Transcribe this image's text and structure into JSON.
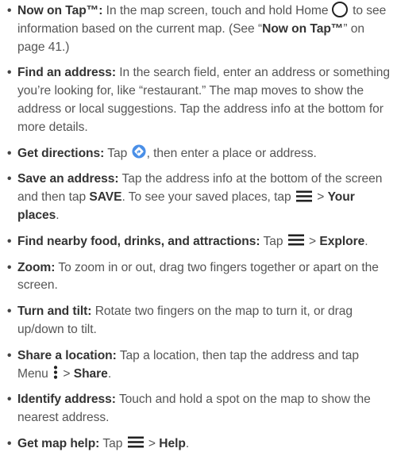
{
  "items": [
    {
      "term": "Now on Tap™:",
      "text1": " In the map screen, touch and hold Home ",
      "icon": "home-circle-icon",
      "text2": " to see information based on the current map. (See “",
      "link": "Now on Tap™",
      "text3": "” on page 41.)"
    },
    {
      "term": "Find an address:",
      "text": " In the search field, enter an address or something you’re looking for, like “restaurant.” The map moves to show the address or local suggestions. Tap the address info at the bottom for more details."
    },
    {
      "term": "Get directions:",
      "text1": " Tap ",
      "icon": "directions-icon",
      "text2": ", then enter a place or address."
    },
    {
      "term": "Save an address:",
      "text1": " Tap the address info at the bottom of the screen and then tap ",
      "strong1": "SAVE",
      "text2": ". To see your saved places, tap ",
      "icon": "menu-icon",
      "text3": " > ",
      "strong2": "Your places",
      "text4": "."
    },
    {
      "term": "Find nearby food, drinks, and attractions:",
      "text1": " Tap ",
      "icon": "menu-icon",
      "text2": " > ",
      "strong": "Explore",
      "text3": "."
    },
    {
      "term": "Zoom:",
      "text": " To zoom in or out, drag two fingers together or apart on the screen."
    },
    {
      "term": "Turn and tilt:",
      "text": " Rotate two fingers on the map to turn it, or drag up/down to tilt."
    },
    {
      "term": "Share a location:",
      "text1": " Tap a location, then tap the address and tap Menu ",
      "icon": "overflow-menu-icon",
      "text2": " > ",
      "strong": "Share",
      "text3": "."
    },
    {
      "term": "Identify address:",
      "text": " Touch and hold a spot on the map to show the nearest address."
    },
    {
      "term": "Get map help:",
      "text1": " Tap ",
      "icon": "menu-icon",
      "text2": " > ",
      "strong": "Help",
      "text3": "."
    }
  ],
  "bullet_char": "•",
  "colors": {
    "body_text": "#555555",
    "bold_text": "#333333",
    "directions_icon": "#4a8fe7"
  }
}
